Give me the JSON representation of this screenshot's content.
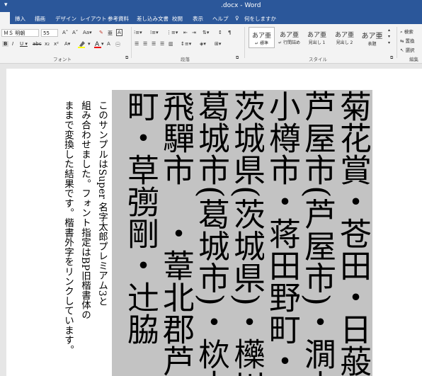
{
  "window": {
    "quick_access": "▾",
    "title": ".docx - Word"
  },
  "tabs": [
    {
      "label": "挿入"
    },
    {
      "label": "描画"
    },
    {
      "label": "デザイン"
    },
    {
      "label": "レイアウト"
    },
    {
      "label": "参考資料"
    },
    {
      "label": "差し込み文書"
    },
    {
      "label": "校閲"
    },
    {
      "label": "表示"
    },
    {
      "label": "ヘルプ"
    },
    {
      "label": "何をしますか"
    }
  ],
  "ribbon": {
    "font_name": "ＭＳ 明朝",
    "font_size": "55",
    "font_group_label": "フォント",
    "paragraph_group_label": "段落",
    "styles_group_label": "スタイル",
    "editing_group_label": "編集",
    "styles": [
      {
        "sample": "あア亜",
        "name": "↵ 標準"
      },
      {
        "sample": "あア亜",
        "name": "↵ 行間詰め"
      },
      {
        "sample": "あア亜",
        "name": "見出し 1"
      },
      {
        "sample": "あア亜",
        "name": "見出し 2"
      },
      {
        "sample": "あア亜",
        "name": "表題"
      }
    ],
    "editing": {
      "find": "検索",
      "replace": "置換",
      "select": "選択"
    }
  },
  "document": {
    "big_columns": [
      "菊花賞・苍田・日蒰",
      "芦屋市(芦屋市)・㵎山",
      "小樽市・蒋田野町・絆",
      "茨城県(茨城県)・㰛川",
      "葛城市(葛城市)・栨木",
      "飛驒市　・葦北郡芦北",
      "町・草彅剛・辻脇"
    ],
    "small_columns": [
      "このサンプルはSuper 名字太郎プレミアム3と",
      "組み合わせました。フォント指定はBP旧楷書体の",
      "ままで変換した結果です。楷書外字をリンクしています。"
    ],
    "colors": {
      "highlight": "#c3c3c3",
      "title_bar": "#2b579a"
    }
  }
}
